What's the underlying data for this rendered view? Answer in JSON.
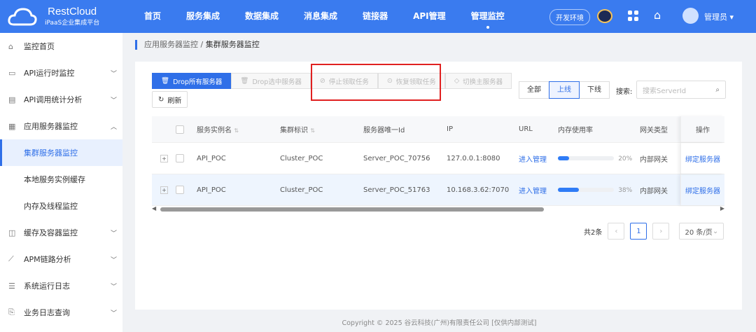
{
  "header": {
    "brand": "RestCloud",
    "subtitle": "iPaaS企业集成平台",
    "nav": [
      "首页",
      "服务集成",
      "数据集成",
      "消息集成",
      "链接器",
      "API管理",
      "管理监控"
    ],
    "active_nav": "管理监控",
    "env": "开发环境",
    "user": "管理员"
  },
  "sidebar": {
    "items": [
      {
        "label": "监控首页",
        "icon": "home-icon"
      },
      {
        "label": "API运行时监控",
        "icon": "monitor-icon",
        "chevron": "down"
      },
      {
        "label": "API调用统计分析",
        "icon": "chart-icon",
        "chevron": "down"
      },
      {
        "label": "应用服务器监控",
        "icon": "server-icon",
        "chevron": "up"
      },
      {
        "label": "集群服务器监控",
        "sub": true,
        "active": true
      },
      {
        "label": "本地服务实例缓存",
        "sub": true
      },
      {
        "label": "内存及线程监控",
        "sub": true
      },
      {
        "label": "缓存及容器监控",
        "icon": "cache-icon",
        "chevron": "down"
      },
      {
        "label": "APM链路分析",
        "icon": "trend-icon",
        "chevron": "down"
      },
      {
        "label": "系统运行日志",
        "icon": "log-icon",
        "chevron": "down"
      },
      {
        "label": "业务日志查询",
        "icon": "search-doc-icon",
        "chevron": "down"
      }
    ]
  },
  "breadcrumb": [
    "应用服务器监控",
    "集群服务器监控"
  ],
  "toolbar": {
    "drop_all": "Drop所有服务器",
    "drop_selected": "Drop选中服务器",
    "stop": "停止领取任务",
    "resume": "恢复领取任务",
    "switch": "切换主服务器",
    "refresh": "刷新"
  },
  "filter": {
    "options": [
      "全部",
      "上线",
      "下线"
    ],
    "selected": "上线",
    "search_label": "搜索:",
    "search_placeholder": "搜索ServerId"
  },
  "table": {
    "columns": [
      "服务实例名",
      "集群标识",
      "服务器唯一Id",
      "IP",
      "URL",
      "内存使用率",
      "网关类型",
      "操作"
    ],
    "rows": [
      {
        "name": "API_POC",
        "cluster": "Cluster_POC",
        "id": "Server_POC_70756",
        "ip": "127.0.0.1:8080",
        "url": "进入管理",
        "mem": 20,
        "mem_label": "20%",
        "gateway": "内部网关",
        "action": "绑定服务器"
      },
      {
        "name": "API_POC",
        "cluster": "Cluster_POC",
        "id": "Server_POC_51763",
        "ip": "10.168.3.62:7070",
        "url": "进入管理",
        "mem": 38,
        "mem_label": "38%",
        "gateway": "内部网关",
        "action": "绑定服务器"
      }
    ]
  },
  "pagination": {
    "total": "共2条",
    "page": "1",
    "page_size": "20 条/页"
  },
  "footer": "Copyright © 2025    谷云科技(广州)有限责任公司 [仅供内部测试]",
  "colors": {
    "primary": "#2f6fe8",
    "header": "#3a7bef",
    "highlight": "#e02020"
  }
}
